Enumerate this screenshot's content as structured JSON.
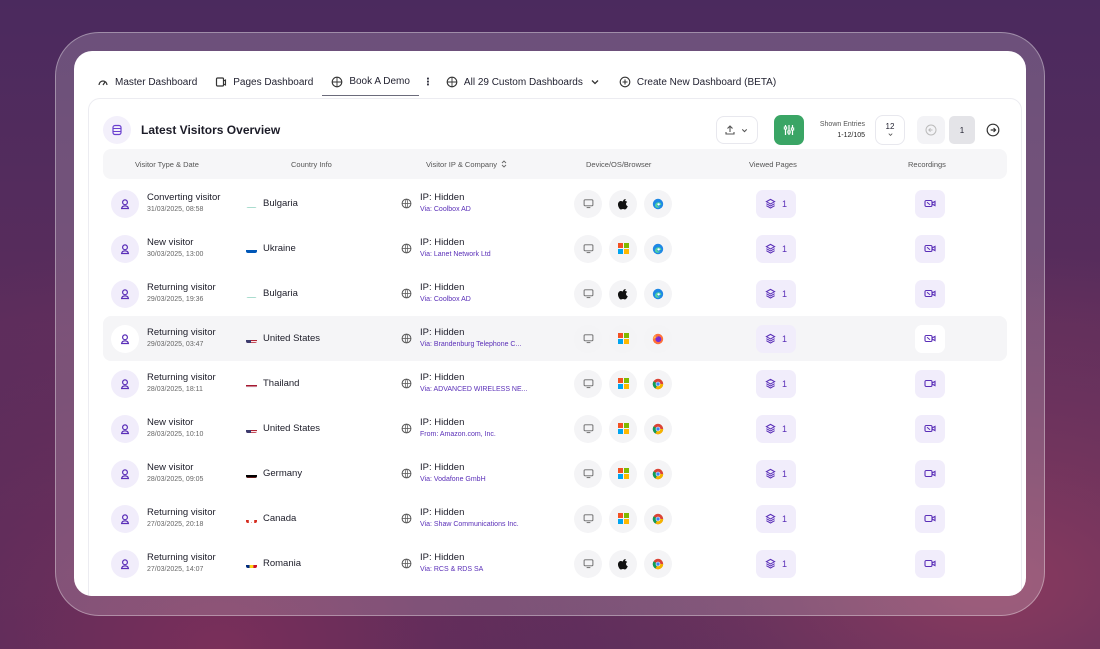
{
  "tabs": [
    {
      "label": "Master Dashboard",
      "icon": "gauge-icon"
    },
    {
      "label": "Pages Dashboard",
      "icon": "screen-icon"
    },
    {
      "label": "Book A Demo",
      "icon": "globe-icon",
      "active": true
    },
    {
      "label": "All 29 Custom Dashboards",
      "icon": "globe-icon"
    },
    {
      "label": "Create New Dashboard (BETA)",
      "icon": "plus-circle-icon"
    }
  ],
  "panel": {
    "title": "Latest Visitors Overview",
    "entries_label": "Shown Entries",
    "entries_value": "1-12/105",
    "per_page": "12",
    "page": "1"
  },
  "columns": [
    "Visitor Type & Date",
    "Country Info",
    "Visitor IP & Company",
    "Device/OS/Browser",
    "Viewed Pages",
    "Recordings"
  ],
  "accent": "#5a2fb8",
  "rows": [
    {
      "type": "Converting visitor",
      "date": "31/03/2025, 08:58",
      "country": "Bulgaria",
      "flag": "bg",
      "ip": "IP: Hidden",
      "via": "Via: Coolbox AD",
      "os": "apple",
      "browser": "edge",
      "pages": "1",
      "rec": "recording-alt",
      "hl": false
    },
    {
      "type": "New visitor",
      "date": "30/03/2025, 13:00",
      "country": "Ukraine",
      "flag": "ua",
      "ip": "IP: Hidden",
      "via": "Via: Lanet Network Ltd",
      "os": "windows",
      "browser": "edge",
      "pages": "1",
      "rec": "recording-alt",
      "hl": false
    },
    {
      "type": "Returning visitor",
      "date": "29/03/2025, 19:36",
      "country": "Bulgaria",
      "flag": "bg",
      "ip": "IP: Hidden",
      "via": "Via: Coolbox AD",
      "os": "apple",
      "browser": "edge",
      "pages": "1",
      "rec": "recording-alt",
      "hl": false
    },
    {
      "type": "Returning visitor",
      "date": "29/03/2025, 03:47",
      "country": "United States",
      "flag": "us",
      "ip": "IP: Hidden",
      "via": "Via: Brandenburg Telephone C...",
      "os": "windows",
      "browser": "firefox",
      "pages": "1",
      "rec": "recording-alt",
      "hl": true
    },
    {
      "type": "Returning visitor",
      "date": "28/03/2025, 18:11",
      "country": "Thailand",
      "flag": "th",
      "ip": "IP: Hidden",
      "via": "Via: ADVANCED WIRELESS NE...",
      "os": "windows",
      "browser": "chrome",
      "pages": "1",
      "rec": "recording",
      "hl": false
    },
    {
      "type": "New visitor",
      "date": "28/03/2025, 10:10",
      "country": "United States",
      "flag": "us",
      "ip": "IP: Hidden",
      "via": "From: Amazon.com, Inc.",
      "os": "windows",
      "browser": "chrome",
      "pages": "1",
      "rec": "recording-alt",
      "hl": false
    },
    {
      "type": "New visitor",
      "date": "28/03/2025, 09:05",
      "country": "Germany",
      "flag": "de",
      "ip": "IP: Hidden",
      "via": "Via: Vodafone GmbH",
      "os": "windows",
      "browser": "chrome",
      "pages": "1",
      "rec": "recording",
      "hl": false
    },
    {
      "type": "Returning visitor",
      "date": "27/03/2025, 20:18",
      "country": "Canada",
      "flag": "ca",
      "ip": "IP: Hidden",
      "via": "Via: Shaw Communications Inc.",
      "os": "windows",
      "browser": "chrome",
      "pages": "1",
      "rec": "recording",
      "hl": false
    },
    {
      "type": "Returning visitor",
      "date": "27/03/2025, 14:07",
      "country": "Romania",
      "flag": "ro",
      "ip": "IP: Hidden",
      "via": "Via: RCS & RDS SA",
      "os": "apple",
      "browser": "chrome",
      "pages": "1",
      "rec": "recording",
      "hl": false
    }
  ]
}
